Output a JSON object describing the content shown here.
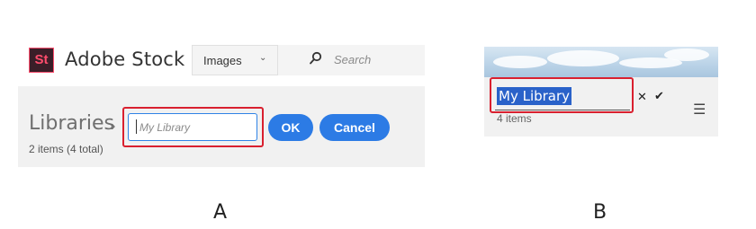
{
  "panel_a": {
    "logo_text": "St",
    "brand": "Adobe Stock",
    "type_select": {
      "value": "Images"
    },
    "search": {
      "placeholder": "Search"
    },
    "libraries": {
      "title": "Libraries",
      "count": "2 items (4 total)"
    },
    "name_input": {
      "placeholder": "My Library"
    },
    "ok_label": "OK",
    "cancel_label": "Cancel",
    "caption": "A"
  },
  "panel_b": {
    "library_name": "My Library",
    "count": "4 items",
    "caption": "B"
  },
  "colors": {
    "accent_blue": "#2c7be5",
    "highlight_red": "#d9202f",
    "logo_bg": "#3a1e28",
    "logo_fg": "#ff4d6d",
    "selection_blue": "#2a62c9"
  }
}
